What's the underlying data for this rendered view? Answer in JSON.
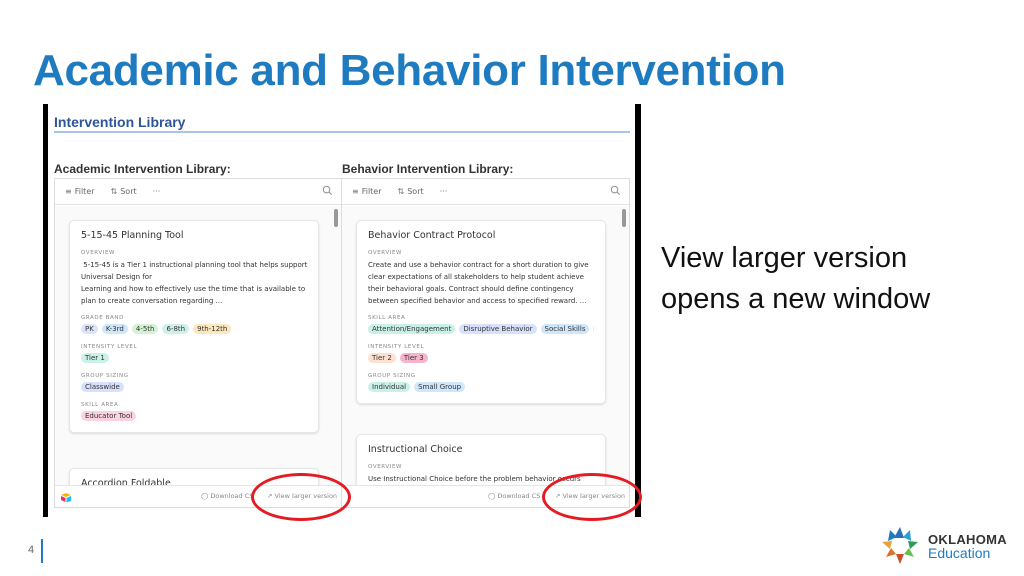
{
  "slide": {
    "title": "Academic and Behavior Intervention",
    "side_text": "View larger version opens a new window",
    "page_number": "4",
    "logo": {
      "line1": "OKLAHOMA",
      "line2": "Education"
    }
  },
  "screenshot": {
    "library_title": "Intervention Library",
    "toolbar": {
      "filter": "Filter",
      "sort": "Sort",
      "more": "···"
    },
    "footer": {
      "download": "Download CSV",
      "download_truncated": "Download CS",
      "view_larger": "View larger version"
    },
    "academic": {
      "heading": "Academic Intervention Library:",
      "cards": [
        {
          "title": "5-15-45 Planning Tool",
          "overview_label": "OVERVIEW",
          "overview": "5-15-45 is a Tier 1 instructional planning tool that helps support Universal Design for Learning and how to effectively use the time that is available to plan to create conversation regarding ...",
          "overview_lines": [
            " 5-15-45 is a Tier 1 instructional planning tool that helps support",
            "Universal Design for",
            "Learning and how to effectively use the time that is available to",
            "plan to create conversation regarding ..."
          ],
          "grade_band_label": "GRADE BAND",
          "grade_band": [
            {
              "label": "PK",
              "color": "#dbe4fb"
            },
            {
              "label": "K-3rd",
              "color": "#cfe6fb"
            },
            {
              "label": "4-5th",
              "color": "#d4f2d6"
            },
            {
              "label": "6-8th",
              "color": "#cdf0ea"
            },
            {
              "label": "9th-12th",
              "color": "#fde8bd"
            }
          ],
          "intensity_label": "INTENSITY LEVEL",
          "intensity": [
            {
              "label": "Tier 1",
              "color": "#c9f1e8"
            }
          ],
          "group_label": "GROUP SIZING",
          "group": [
            {
              "label": "Classwide",
              "color": "#d7e1fb"
            }
          ],
          "skill_label": "SKILL AREA",
          "skill": [
            {
              "label": "Educator Tool",
              "color": "#fbd3de"
            }
          ]
        },
        {
          "title": "Accordion Foldable"
        }
      ]
    },
    "behavior": {
      "heading": "Behavior Intervention Library:",
      "cards": [
        {
          "title": "Behavior Contract Protocol",
          "overview_label": "OVERVIEW",
          "overview_lines": [
            "Create and use a behavior contract for a short duration to give",
            "clear expectations of all stakeholders to help student achieve",
            "their behavioral goals. Contract should define contingency",
            "between specified behavior and access to specified reward. ..."
          ],
          "skill_label": "SKILL AREA",
          "skill": [
            {
              "label": "Attention/Engagement",
              "color": "#c9f1e8"
            },
            {
              "label": "Disruptive Behavior",
              "color": "#d7e1fb"
            },
            {
              "label": "Social Skills",
              "color": "#cfe6fb"
            },
            {
              "label": "",
              "color": "#d4f2d6"
            }
          ],
          "intensity_label": "INTENSITY LEVEL",
          "intensity": [
            {
              "label": "Tier 2",
              "color": "#fde0cf"
            },
            {
              "label": "Tier 3",
              "color": "#f8b3cc"
            }
          ],
          "group_label": "GROUP SIZING",
          "group": [
            {
              "label": "Individual",
              "color": "#c9f1e8"
            },
            {
              "label": "Small Group",
              "color": "#cfe6fb"
            }
          ]
        },
        {
          "title": "Instructional Choice",
          "overview_label": "OVERVIEW",
          "overview_lines": [
            "Use Instructional Choice before the problem behavior occurs"
          ]
        }
      ]
    }
  },
  "colors": {
    "title_blue": "#1f7bc0",
    "highlight_red": "#e31c23"
  }
}
